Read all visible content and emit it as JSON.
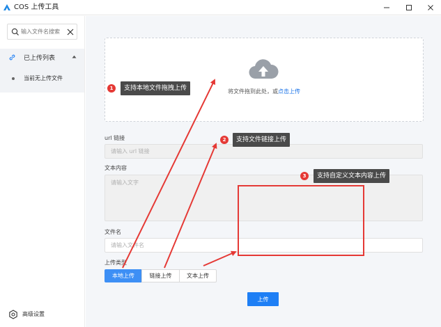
{
  "window": {
    "title": "COS 上传工具",
    "controls": {
      "minimize": "—",
      "maximize": "☐",
      "close": "✕"
    }
  },
  "sidebar": {
    "search": {
      "placeholder": "输入文件名搜索",
      "value": ""
    },
    "group": {
      "title": "已上传列表",
      "expanded": true,
      "items": [
        {
          "label": "当前无上传文件"
        }
      ]
    },
    "settings_label": "高级设置"
  },
  "main": {
    "dropzone": {
      "text": "将文件拖到此处，或",
      "link": "点击上传"
    },
    "url_field": {
      "label": "url 链接",
      "placeholder": "请输入 url 链接",
      "value": ""
    },
    "text_field": {
      "label": "文本内容",
      "placeholder": "请输入文字",
      "value": ""
    },
    "name_field": {
      "label": "文件名",
      "placeholder": "请输入文件名",
      "value": ""
    },
    "upload_type": {
      "label": "上传类型",
      "options": [
        "本地上传",
        "链接上传",
        "文本上传"
      ],
      "selected": "本地上传"
    },
    "submit_label": "上传"
  },
  "annotations": [
    {
      "number": "1",
      "text": "支持本地文件拖拽上传"
    },
    {
      "number": "2",
      "text": "支持文件链接上传"
    },
    {
      "number": "3",
      "text": "支持自定义文本内容上传"
    }
  ],
  "colors": {
    "accent": "#1e7ff5",
    "segment_active": "#3d8ff5",
    "annotation": "#e53935",
    "callout_bg": "#4a4a4a",
    "link": "#1a73e8"
  }
}
